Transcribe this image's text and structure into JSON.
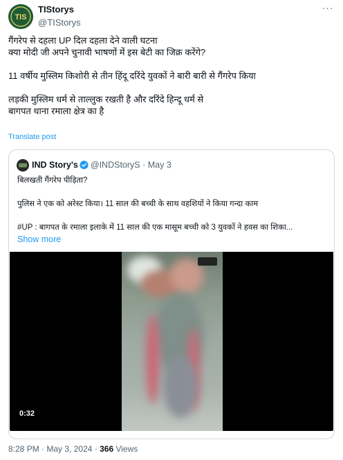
{
  "author": {
    "display_name": "TIStorys",
    "handle": "@TIStorys",
    "avatar_text": "TIS"
  },
  "menu_label": "···",
  "tweet": {
    "lines": [
      "गैंगरेप से दहला UP दिल दहला देने वाली घटना",
      "क्या मोदी जी अपने चुनावी भाषणों में इस बेटी का जिक्र करेंगे?",
      "",
      "11 वर्षीय मुस्लिम किशोरी से तीन हिंदू दरिंदे युवकों ने बारी बारी से गैंगरेप किया",
      "",
      "लड़की मुस्लिम धर्म से ताल्लुक रखती है और दरिंदे हिन्दू धर्म से",
      "बागपत धाना रमाला क्षेत्र का है"
    ],
    "translate_label": "Translate post"
  },
  "quoted": {
    "display_name": "IND Story's",
    "handle": "@INDStoryS",
    "separator": "·",
    "date": "May 3",
    "lines": [
      "बिलखती गैंगरेप पीड़िता?",
      "",
      "पुलिस ने एक को अरेस्ट किया। 11 साल की बच्ची के साथ वहशियों ने किया गन्दा काम",
      "",
      "#UP : बागपत के रमाला इलाके में 11 साल की एक मासूम बच्ची को 3 युवकों ने हवस का शिका..."
    ],
    "show_more": "Show more",
    "video": {
      "duration": "0:32"
    }
  },
  "footer": {
    "time": "8:28 PM",
    "sep1": " · ",
    "date": "May 3, 2024",
    "sep2": " · ",
    "views_count": "366",
    "views_label": " Views"
  },
  "colors": {
    "link": "#1d9bf0",
    "muted": "#536471",
    "text": "#0f1419",
    "border": "#cfd9de"
  }
}
